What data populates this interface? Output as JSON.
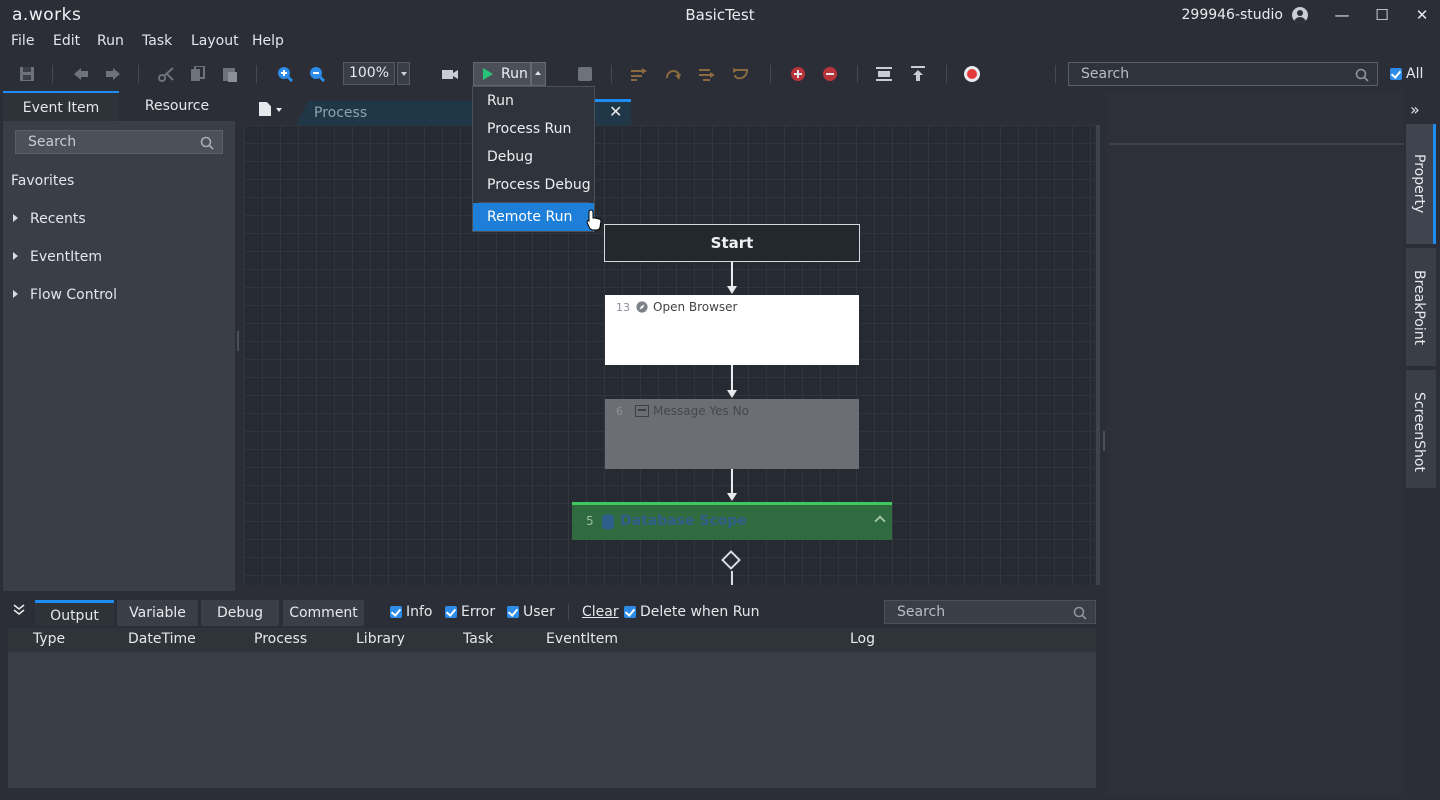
{
  "app": {
    "logo": "a.works",
    "title": "BasicTest",
    "user": "299946-studio"
  },
  "window": {
    "minimize": "—",
    "maximize": "☐",
    "close": "✕"
  },
  "menu": [
    "File",
    "Edit",
    "Run",
    "Task",
    "Layout",
    "Help"
  ],
  "toolbar": {
    "zoom": "100%",
    "run_label": "Run",
    "search_placeholder": "Search",
    "all_label": "All"
  },
  "left_panel": {
    "tabs": [
      "Event Item",
      "Resource"
    ],
    "search_placeholder": "Search",
    "favorites": "Favorites",
    "tree": [
      "Recents",
      "EventItem",
      "Flow Control"
    ]
  },
  "editor": {
    "tab_label": "Process",
    "close": "✕",
    "nodes": {
      "start": "Start",
      "open_browser": {
        "num": "13",
        "title": "Open Browser"
      },
      "message": {
        "num": "6",
        "title": "Message Yes No"
      },
      "db_scope": {
        "num": "5",
        "title": "Database Scope"
      }
    }
  },
  "run_menu": {
    "items": [
      "Run",
      "Process Run",
      "Debug",
      "Process Debug"
    ],
    "highlighted": "Remote Run"
  },
  "side_rail": {
    "tabs": [
      "Property",
      "BreakPoint",
      "ScreenShot"
    ]
  },
  "bottom": {
    "tabs": [
      "Output",
      "Variable",
      "Debug",
      "Comment"
    ],
    "filters": [
      "Info",
      "Error",
      "User"
    ],
    "clear": "Clear",
    "delete_when_run": "Delete when Run",
    "search_placeholder": "Search",
    "columns": [
      "Type",
      "DateTime",
      "Process",
      "Library",
      "Task",
      "EventItem",
      "Log"
    ]
  },
  "colors": {
    "accent": "#1d8df2",
    "run_green": "#29c27a",
    "db_green": "#3ec95f",
    "record_red": "#e23a3a"
  }
}
